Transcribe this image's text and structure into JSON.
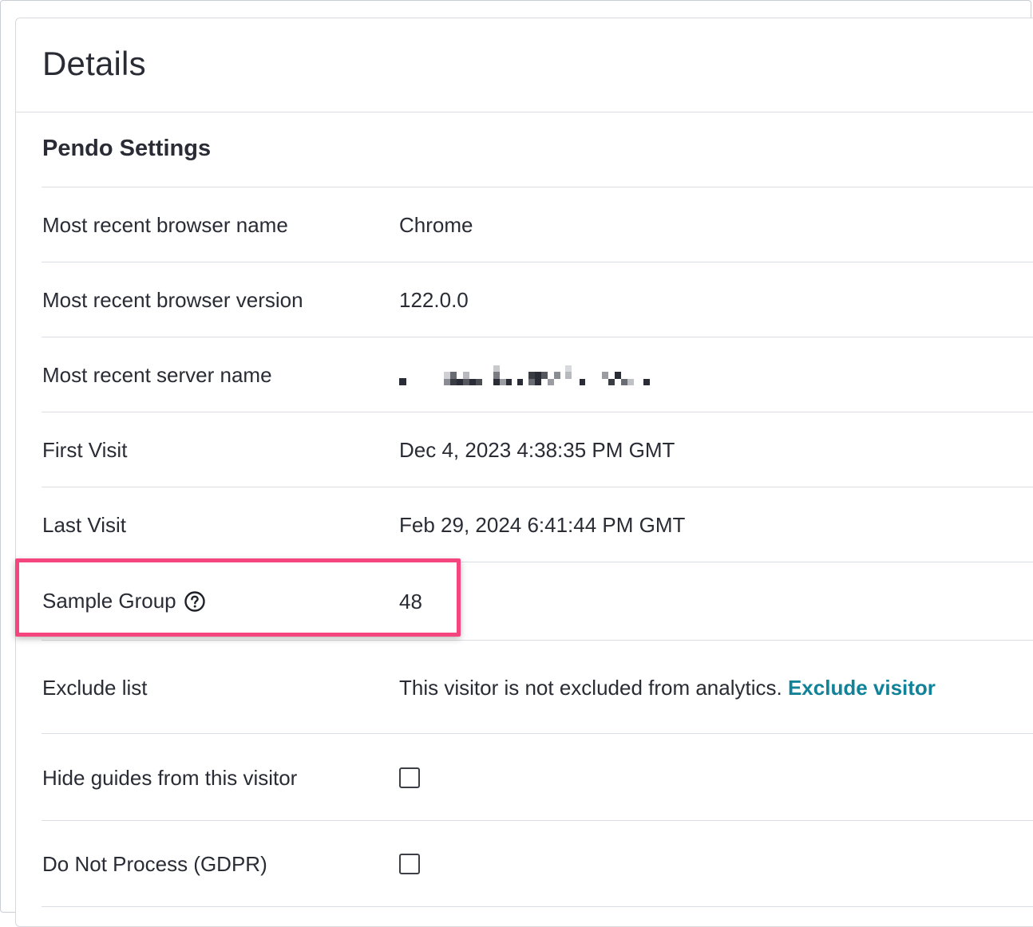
{
  "card": {
    "title": "Details"
  },
  "section": {
    "title": "Pendo Settings"
  },
  "rows": {
    "browser_name": {
      "label": "Most recent browser name",
      "value": "Chrome"
    },
    "browser_version": {
      "label": "Most recent browser version",
      "value": "122.0.0"
    },
    "server_name": {
      "label": "Most recent server name",
      "value_redacted": true
    },
    "first_visit": {
      "label": "First Visit",
      "value": "Dec 4, 2023 4:38:35 PM GMT"
    },
    "last_visit": {
      "label": "Last Visit",
      "value": "Feb 29, 2024 6:41:44 PM GMT"
    },
    "sample_group": {
      "label": "Sample Group",
      "value": "48",
      "help_icon": "question-circle-icon"
    },
    "exclude_list": {
      "label": "Exclude list",
      "value": "This visitor is not excluded from analytics.",
      "link": "Exclude visitor"
    },
    "hide_guides": {
      "label": "Hide guides from this visitor",
      "checked": false
    },
    "do_not_process": {
      "label": "Do Not Process (GDPR)",
      "checked": false
    }
  },
  "colors": {
    "text": "#2a2c35",
    "link": "#128299",
    "highlight": "#f5457e",
    "divider": "#dadde1"
  }
}
